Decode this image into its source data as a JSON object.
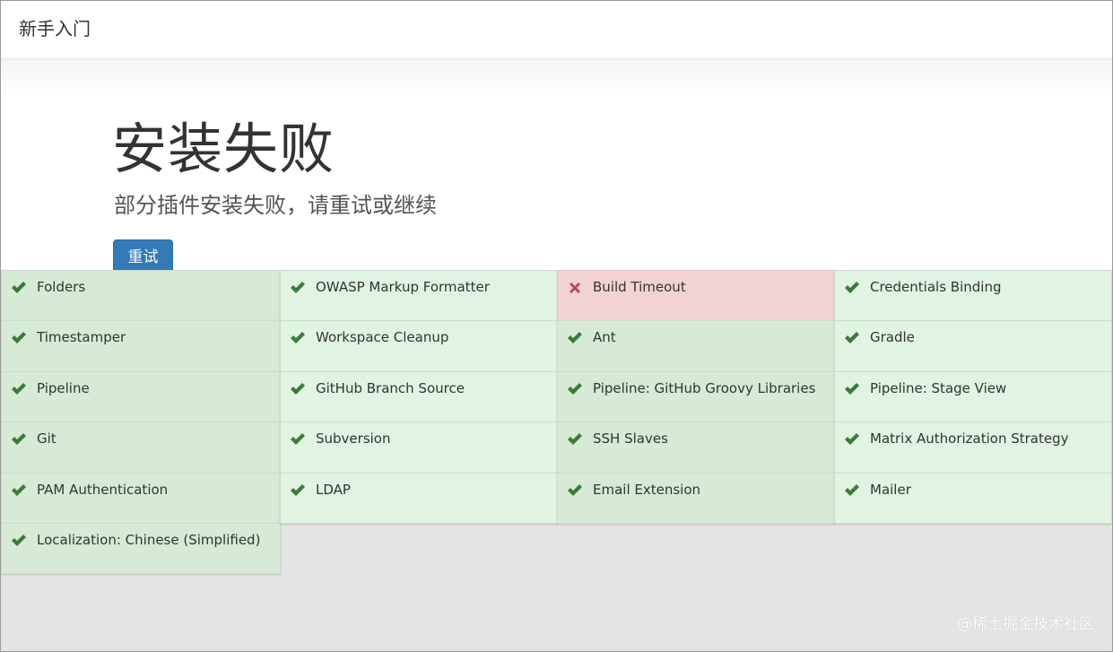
{
  "header": {
    "title": "新手入门"
  },
  "hero": {
    "title": "安装失败",
    "subtitle": "部分插件安装失败，请重试或继续",
    "retry_label": "重试"
  },
  "plugins": [
    {
      "name": "Folders",
      "status": "success"
    },
    {
      "name": "OWASP Markup Formatter",
      "status": "success"
    },
    {
      "name": "Build Timeout",
      "status": "failed"
    },
    {
      "name": "Credentials Binding",
      "status": "success"
    },
    {
      "name": "Timestamper",
      "status": "success"
    },
    {
      "name": "Workspace Cleanup",
      "status": "success"
    },
    {
      "name": "Ant",
      "status": "success"
    },
    {
      "name": "Gradle",
      "status": "success"
    },
    {
      "name": "Pipeline",
      "status": "success"
    },
    {
      "name": "GitHub Branch Source",
      "status": "success"
    },
    {
      "name": "Pipeline: GitHub Groovy Libraries",
      "status": "success"
    },
    {
      "name": "Pipeline: Stage View",
      "status": "success"
    },
    {
      "name": "Git",
      "status": "success"
    },
    {
      "name": "Subversion",
      "status": "success"
    },
    {
      "name": "SSH Slaves",
      "status": "success"
    },
    {
      "name": "Matrix Authorization Strategy",
      "status": "success"
    },
    {
      "name": "PAM Authentication",
      "status": "success"
    },
    {
      "name": "LDAP",
      "status": "success"
    },
    {
      "name": "Email Extension",
      "status": "success"
    },
    {
      "name": "Mailer",
      "status": "success"
    },
    {
      "name": "Localization: Chinese (Simplified)",
      "status": "success"
    }
  ],
  "icons": {
    "success": "check-icon",
    "failed": "cross-icon"
  },
  "colors": {
    "success_light": "#e1f4e1",
    "success_dark": "#d6ead6",
    "failed": "#f2d2d2",
    "check": "#3b7a3b",
    "cross": "#b94a48",
    "primary": "#337ab7"
  },
  "watermark": "@稀土掘金技术社区"
}
